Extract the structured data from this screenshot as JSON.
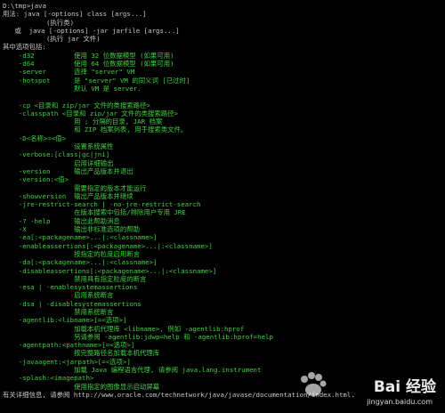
{
  "terminal": {
    "lines": [
      {
        "t": "D:\\tmp>java",
        "c": "gray"
      },
      {
        "t": "用法: java [-options] class [args...]",
        "c": "gray"
      },
      {
        "t": "           (执行类)",
        "c": "gray"
      },
      {
        "t": "   或  java [-options] -jar jarfile [args...]",
        "c": "gray"
      },
      {
        "t": "           (执行 jar 文件)",
        "c": "gray"
      },
      {
        "t": "其中选项包括:",
        "c": "gray"
      },
      {
        "t": "    -d32          使用 32 位数据模型 (如果可用)",
        "c": "green"
      },
      {
        "t": "    -d64          使用 64 位数据模型 (如果可用)",
        "c": "green"
      },
      {
        "t": "    -server       选择 \"server\" VM",
        "c": "green"
      },
      {
        "t": "    -hotspot      是 \"server\" VM 的同义词 [已过时]",
        "c": "green"
      },
      {
        "t": "                  默认 VM 是 server.",
        "c": "green"
      },
      {
        "t": "",
        "c": "green"
      },
      {
        "t": "    -cp <目录和 zip/jar 文件的类搜索路径>",
        "c": "green"
      },
      {
        "t": "    -classpath <目录和 zip/jar 文件的类搜索路径>",
        "c": "green"
      },
      {
        "t": "                  用 ; 分隔的目录, JAR 档案",
        "c": "green"
      },
      {
        "t": "                  和 ZIP 档案列表, 用于搜索类文件。",
        "c": "green"
      },
      {
        "t": "    -D<名称>=<值>",
        "c": "green"
      },
      {
        "t": "                  设置系统属性",
        "c": "green"
      },
      {
        "t": "    -verbose:[class|gc|jni]",
        "c": "green"
      },
      {
        "t": "                  启用详细输出",
        "c": "green"
      },
      {
        "t": "    -version      输出产品版本并退出",
        "c": "green"
      },
      {
        "t": "    -version:<值>",
        "c": "green"
      },
      {
        "t": "                  需要指定的版本才能运行",
        "c": "green"
      },
      {
        "t": "    -showversion  输出产品版本并继续",
        "c": "green"
      },
      {
        "t": "    -jre-restrict-search | -no-jre-restrict-search",
        "c": "green"
      },
      {
        "t": "                  在版本搜索中包括/排除用户专用 JRE",
        "c": "green"
      },
      {
        "t": "    -? -help      输出此帮助消息",
        "c": "green"
      },
      {
        "t": "    -X            输出非标准选项的帮助",
        "c": "green"
      },
      {
        "t": "    -ea[:<packagename>...|:<classname>]",
        "c": "green"
      },
      {
        "t": "    -enableassertions[:<packagename>...|:<classname>]",
        "c": "green"
      },
      {
        "t": "                  按指定的粒度启用断言",
        "c": "green"
      },
      {
        "t": "    -da[:<packagename>...|:<classname>]",
        "c": "green"
      },
      {
        "t": "    -disableassertions[:<packagename>...|:<classname>]",
        "c": "green"
      },
      {
        "t": "                  禁用具有指定粒度的断言",
        "c": "green"
      },
      {
        "t": "    -esa | -enablesystemassertions",
        "c": "green"
      },
      {
        "t": "                  启用系统断言",
        "c": "green"
      },
      {
        "t": "    -dsa | -disablesystemassertions",
        "c": "green"
      },
      {
        "t": "                  禁用系统断言",
        "c": "green"
      },
      {
        "t": "    -agentlib:<libname>[=<选项>]",
        "c": "green"
      },
      {
        "t": "                  加载本机代理库 <libname>, 例如 -agentlib:hprof",
        "c": "green"
      },
      {
        "t": "                  另请参阅 -agentlib:jdwp=help 和 -agentlib:hprof=help",
        "c": "green"
      },
      {
        "t": "    -agentpath:<pathname>[=<选项>]",
        "c": "green"
      },
      {
        "t": "                  按完整路径名加载本机代理库",
        "c": "green"
      },
      {
        "t": "    -javaagent:<jarpath>[=<选项>]",
        "c": "green"
      },
      {
        "t": "                  加载 Java 编程语言代理, 请参阅 java.lang.instrument",
        "c": "green"
      },
      {
        "t": "    -splash:<imagepath>",
        "c": "green"
      },
      {
        "t": "                  使用指定的图像显示启动屏幕",
        "c": "green"
      },
      {
        "t": "有关详细信息, 请参阅 http://www.oracle.com/technetwork/java/javase/documentation/index.html.",
        "c": "gray"
      }
    ]
  },
  "watermark": {
    "brand": "Bai 经验",
    "url": "jingyan.baidu.com"
  }
}
